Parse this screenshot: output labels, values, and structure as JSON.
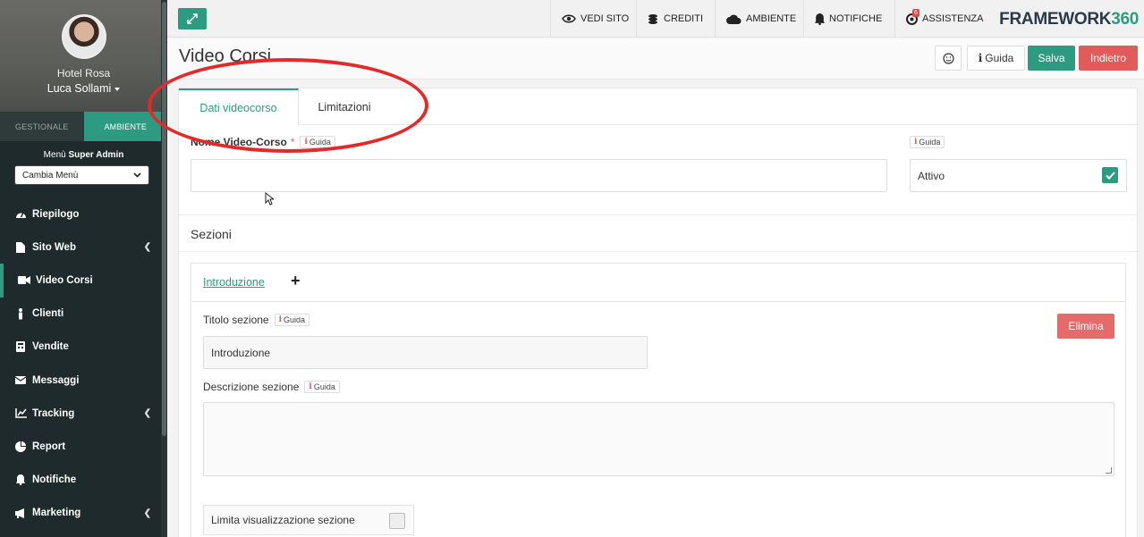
{
  "sidebar": {
    "hotel": "Hotel Rosa",
    "user": "Luca Sollami",
    "tabs": {
      "gestionale": "GESTIONALE",
      "ambiente": "AMBIENTE"
    },
    "menu_label_prefix": "Menù",
    "menu_label_bold": "Super Admin",
    "menu_select": "Cambia Menù",
    "items": [
      {
        "label": "Riepilogo",
        "icon": "dashboard-icon"
      },
      {
        "label": "Sito Web",
        "icon": "file-icon",
        "submenu": true
      },
      {
        "label": "Video Corsi",
        "icon": "video-camera-icon",
        "active": true
      },
      {
        "label": "Clienti",
        "icon": "person-icon"
      },
      {
        "label": "Vendite",
        "icon": "calculator-icon"
      },
      {
        "label": "Messaggi",
        "icon": "envelope-icon"
      },
      {
        "label": "Tracking",
        "icon": "line-chart-icon",
        "submenu": true
      },
      {
        "label": "Report",
        "icon": "pie-chart-icon"
      },
      {
        "label": "Notifiche",
        "icon": "bell-icon"
      },
      {
        "label": "Marketing",
        "icon": "megaphone-icon",
        "submenu": true
      }
    ]
  },
  "topbar": {
    "vedi_sito": "VEDI SITO",
    "crediti": "CREDITI",
    "ambiente": "AMBIENTE",
    "notifiche": "NOTIFICHE",
    "assistenza": "ASSISTENZA",
    "assistenza_badge": "6",
    "brand_main": "FRAMEWORK",
    "brand_num": "360"
  },
  "header": {
    "title": "Video Corsi",
    "guida": "Guida",
    "salva": "Salva",
    "indietro": "Indietro"
  },
  "form": {
    "tabs": {
      "dati": "Dati videocorso",
      "limitazioni": "Limitazioni"
    },
    "nome_label": "Nome Video-Corso",
    "required_mark": "*",
    "guida_chip": "Guida",
    "nome_value": "",
    "attivo_label": "Attivo",
    "attivo_checked": true,
    "sezioni_title": "Sezioni",
    "section_tab": "Introduzione",
    "add_section": "+",
    "titolo_label": "Titolo sezione",
    "titolo_value": "Introduzione",
    "descrizione_label": "Descrizione sezione",
    "elimina": "Elimina",
    "limita_label": "Limita visualizzazione sezione"
  },
  "colors": {
    "accent": "#2c9b82",
    "danger": "#e15b5b",
    "sidebar_bg": "#1e2a2b",
    "annotation": "#e22a2a"
  }
}
